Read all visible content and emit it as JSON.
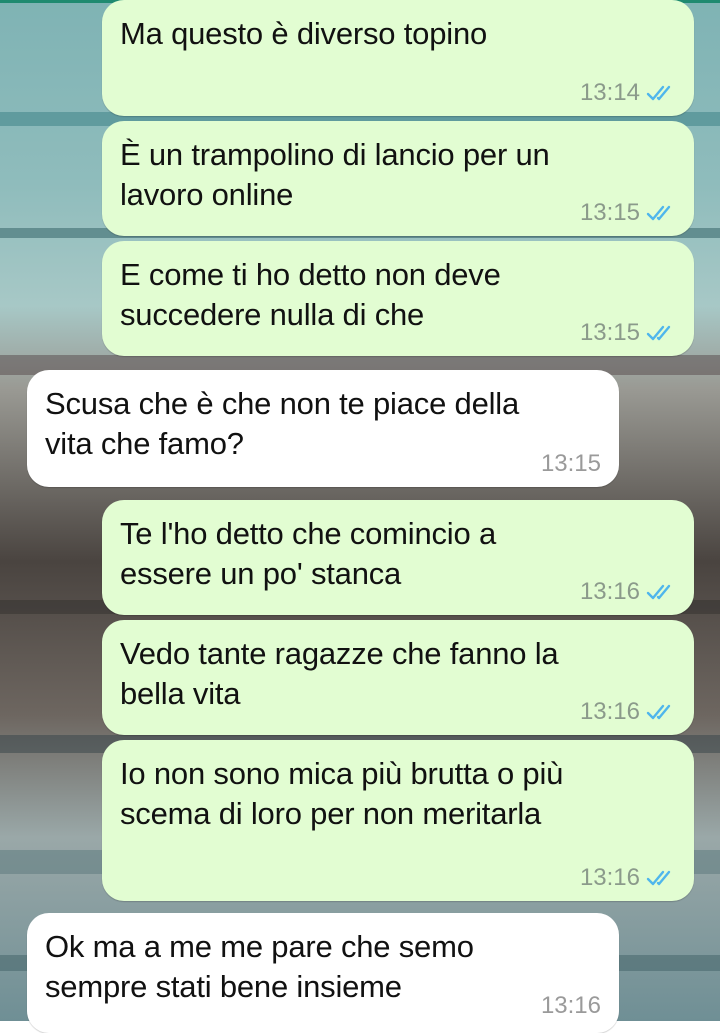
{
  "theme": {
    "outgoing_bubble": "#e2fdd2",
    "incoming_bubble": "#ffffff",
    "read_ticks_color": "#4fb6ec",
    "timestamp_color": "#8b9a8b"
  },
  "messages": [
    {
      "direction": "out",
      "text": "Ma questo è diverso topino",
      "time": "13:14",
      "status_icon": "double-check-read-icon"
    },
    {
      "direction": "out",
      "text": "È un trampolino di lancio per un\nlavoro online",
      "time": "13:15",
      "status_icon": "double-check-read-icon"
    },
    {
      "direction": "out",
      "text": "E come ti ho detto non deve\nsuccedere nulla di che",
      "time": "13:15",
      "status_icon": "double-check-read-icon"
    },
    {
      "direction": "in",
      "text": "Scusa che è che non te piace della\nvita che famo?",
      "time": "13:15"
    },
    {
      "direction": "out",
      "text": "Te l'ho detto che comincio a\nessere un po' stanca",
      "time": "13:16",
      "status_icon": "double-check-read-icon"
    },
    {
      "direction": "out",
      "text": "Vedo tante ragazze che fanno la\nbella vita",
      "time": "13:16",
      "status_icon": "double-check-read-icon"
    },
    {
      "direction": "out",
      "text": "Io non sono mica più brutta o più\nscema di loro per non meritarla",
      "time": "13:16",
      "status_icon": "double-check-read-icon"
    },
    {
      "direction": "in",
      "text": "Ok ma a me me pare che semo\nsempre stati bene insieme",
      "time": "13:16"
    }
  ]
}
